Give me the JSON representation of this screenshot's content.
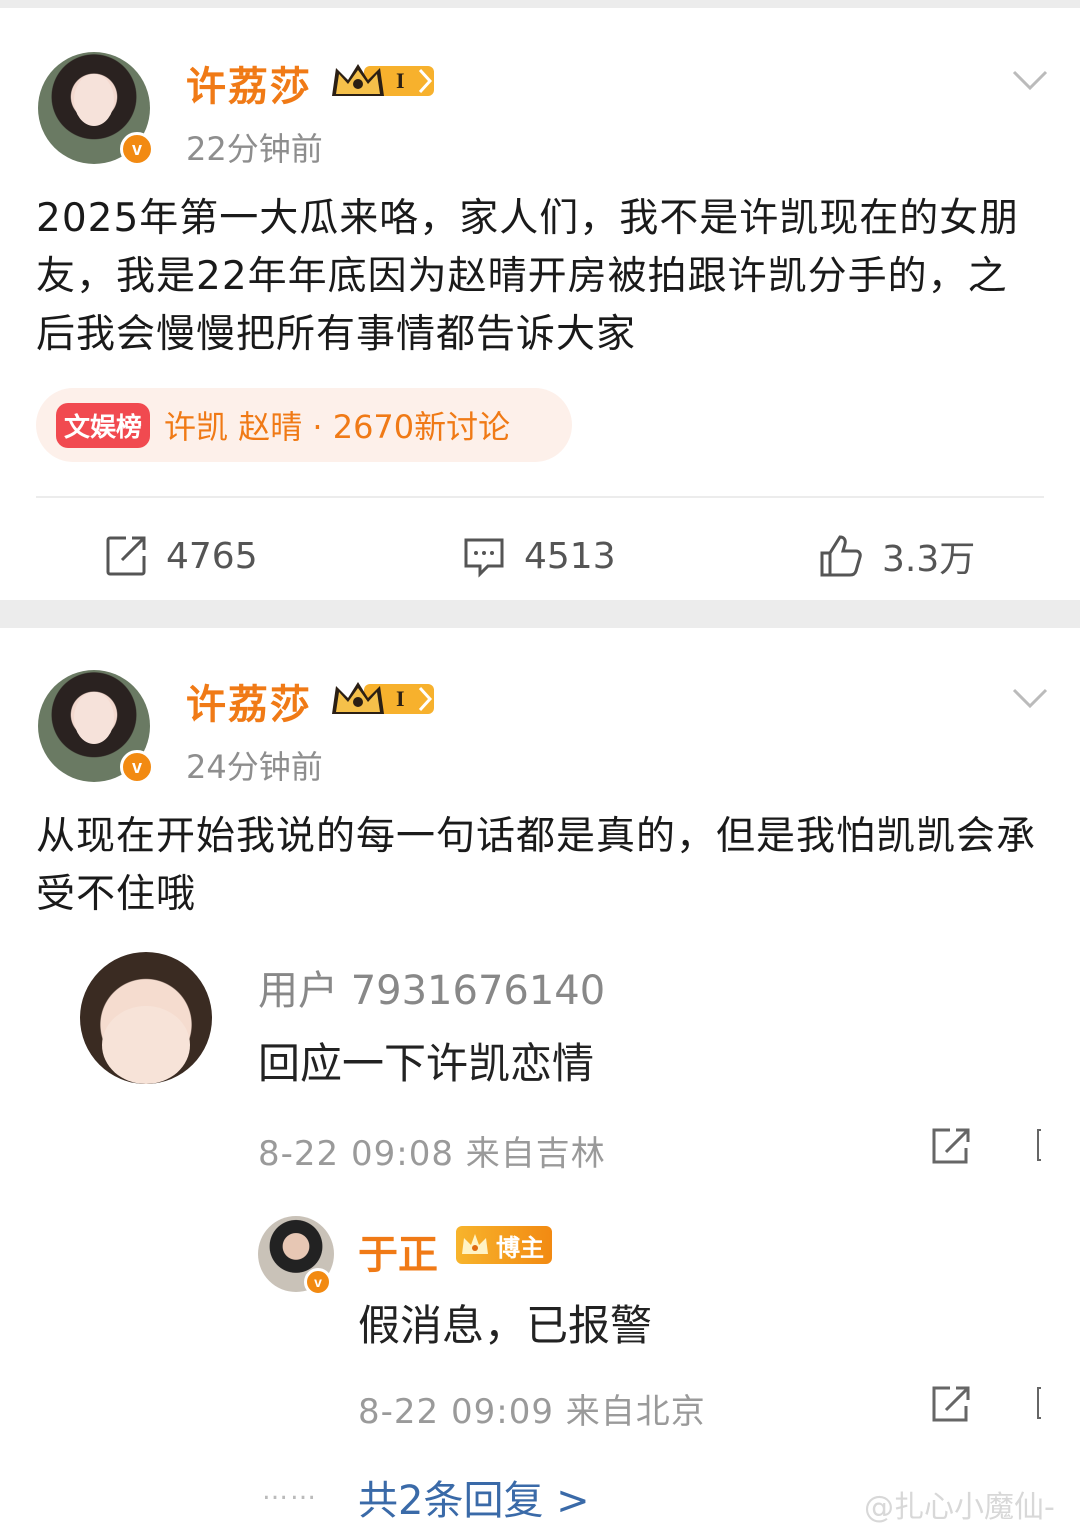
{
  "posts": [
    {
      "username": "许荔莎",
      "time": "22分钟前",
      "text": "2025年第一大瓜来咯，家人们，我不是许凯现在的女朋友，我是22年年底因为赵晴开房被拍跟许凯分手的，之后我会慢慢把所有事情都告诉大家",
      "topic": {
        "tag": "文娱榜",
        "text": "许凯 赵晴 · 2670新讨论"
      },
      "actions": {
        "repost": "4765",
        "comment": "4513",
        "like": "3.3万"
      }
    },
    {
      "username": "许荔莎",
      "time": "24分钟前",
      "text": "从现在开始我说的每一句话都是真的，但是我怕凯凯会承受不住哦"
    }
  ],
  "comment": {
    "name": "用户 7931676140",
    "text": "回应一下许凯恋情",
    "meta": "8-22 09:08 来自吉林"
  },
  "reply": {
    "name": "于正",
    "badge": "博主",
    "text": "假消息，已报警",
    "meta": "8-22 09:09 来自北京"
  },
  "more_replies": "共2条回复 >",
  "dots": "……",
  "watermark": "@扎心小魔仙-",
  "colors": {
    "accent": "#f07a16",
    "link": "#3a6aa8",
    "tag": "#f14a50"
  },
  "icons": [
    "crown-level-badge",
    "verified-v-icon",
    "chevron-down-icon",
    "repost-icon",
    "comment-icon",
    "like-icon",
    "share-icon"
  ]
}
